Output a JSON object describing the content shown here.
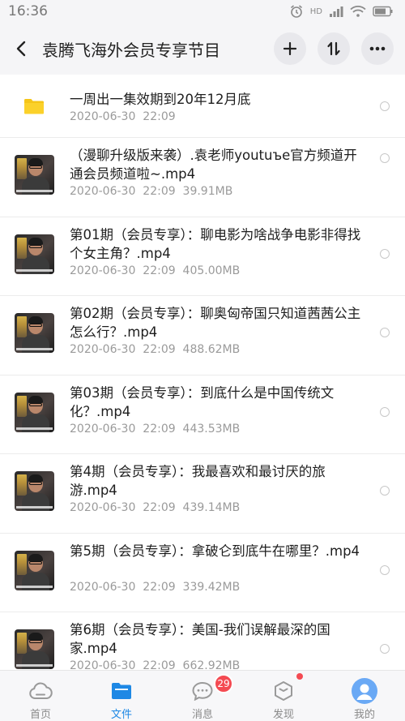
{
  "status": {
    "time": "16:36",
    "network": "HD"
  },
  "header": {
    "title": "袁腾飞海外会员专享节目"
  },
  "files": [
    {
      "kind": "folder",
      "name": "一周出一集效期到20年12月底",
      "date": "2020-06-30",
      "time": "22:09",
      "size": ""
    },
    {
      "kind": "video",
      "name": "（漫聊升级版来袭）.袁老师youtuъe官方频道开通会员频道啦~.mp4",
      "date": "2020-06-30",
      "time": "22:09",
      "size": "39.91MB"
    },
    {
      "kind": "video",
      "name": "第01期（会员专享）：聊电影为啥战争电影非得找个女主角？.mp4",
      "date": "2020-06-30",
      "time": "22:09",
      "size": "405.00MB"
    },
    {
      "kind": "video",
      "name": "第02期（会员专享）：聊奥匈帝国只知道茜茜公主怎么行？.mp4",
      "date": "2020-06-30",
      "time": "22:09",
      "size": "488.62MB"
    },
    {
      "kind": "video",
      "name": "第03期（会员专享）：到底什么是中国传统文化？.mp4",
      "date": "2020-06-30",
      "time": "22:09",
      "size": "443.53MB"
    },
    {
      "kind": "video",
      "name": "第4期（会员专享）：我最喜欢和最讨厌的旅游.mp4",
      "date": "2020-06-30",
      "time": "22:09",
      "size": "439.14MB"
    },
    {
      "kind": "video",
      "name": "第5期（会员专享）：拿破仑到底牛在哪里？.mp4",
      "date": "2020-06-30",
      "time": "22:09",
      "size": "339.42MB"
    },
    {
      "kind": "video",
      "name": "第6期（会员专享）：美国-我们误解最深的国家.mp4",
      "date": "2020-06-30",
      "time": "22:09",
      "size": "662.92MB"
    }
  ],
  "tabs": [
    {
      "label": "首页",
      "icon": "cloud-icon"
    },
    {
      "label": "文件",
      "icon": "folder-icon"
    },
    {
      "label": "消息",
      "icon": "chat-icon",
      "badge": "29"
    },
    {
      "label": "发现",
      "icon": "discover-icon"
    },
    {
      "label": "我的",
      "icon": "avatar-icon"
    }
  ],
  "colors": {
    "accent": "#1e88e5",
    "folder": "#f5c518",
    "badge": "#f44a52"
  }
}
